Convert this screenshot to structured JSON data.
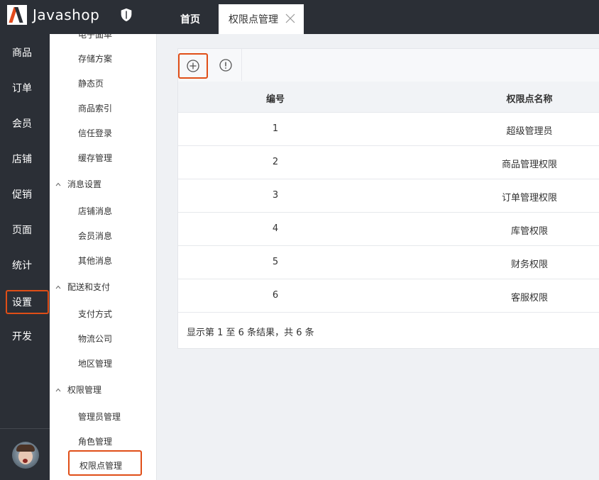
{
  "app": {
    "name": "Javashop"
  },
  "tabs": [
    {
      "label": "首页"
    },
    {
      "label": "权限点管理"
    }
  ],
  "left_nav": {
    "items": [
      {
        "label": "商品"
      },
      {
        "label": "订单"
      },
      {
        "label": "会员"
      },
      {
        "label": "店铺"
      },
      {
        "label": "促销"
      },
      {
        "label": "页面"
      },
      {
        "label": "统计"
      },
      {
        "label": "设置"
      },
      {
        "label": "开发"
      }
    ],
    "selected": "设置"
  },
  "submenu": {
    "partial_top": "电子面单",
    "items_top": [
      "存储方案",
      "静态页",
      "商品索引",
      "信任登录",
      "缓存管理"
    ],
    "groups": [
      {
        "label": "消息设置",
        "items": [
          "店铺消息",
          "会员消息",
          "其他消息"
        ]
      },
      {
        "label": "配送和支付",
        "items": [
          "支付方式",
          "物流公司",
          "地区管理"
        ]
      },
      {
        "label": "权限管理",
        "items": [
          "管理员管理",
          "角色管理",
          "权限点管理"
        ]
      }
    ],
    "selected": "权限点管理"
  },
  "toolbar": {
    "add_icon": "plus-circle-icon",
    "info_icon": "exclamation-circle-icon"
  },
  "table": {
    "columns": [
      "编号",
      "权限点名称"
    ],
    "rows": [
      [
        "1",
        "超级管理员"
      ],
      [
        "2",
        "商品管理权限"
      ],
      [
        "3",
        "订单管理权限"
      ],
      [
        "4",
        "库管权限"
      ],
      [
        "5",
        "财务权限"
      ],
      [
        "6",
        "客服权限"
      ]
    ],
    "summary": "显示第 1 至 6 条结果，共 6 条"
  },
  "colors": {
    "dark_nav": "#2b2f36",
    "highlight": "#e04e17",
    "logo_accent": "#e24a1c"
  }
}
